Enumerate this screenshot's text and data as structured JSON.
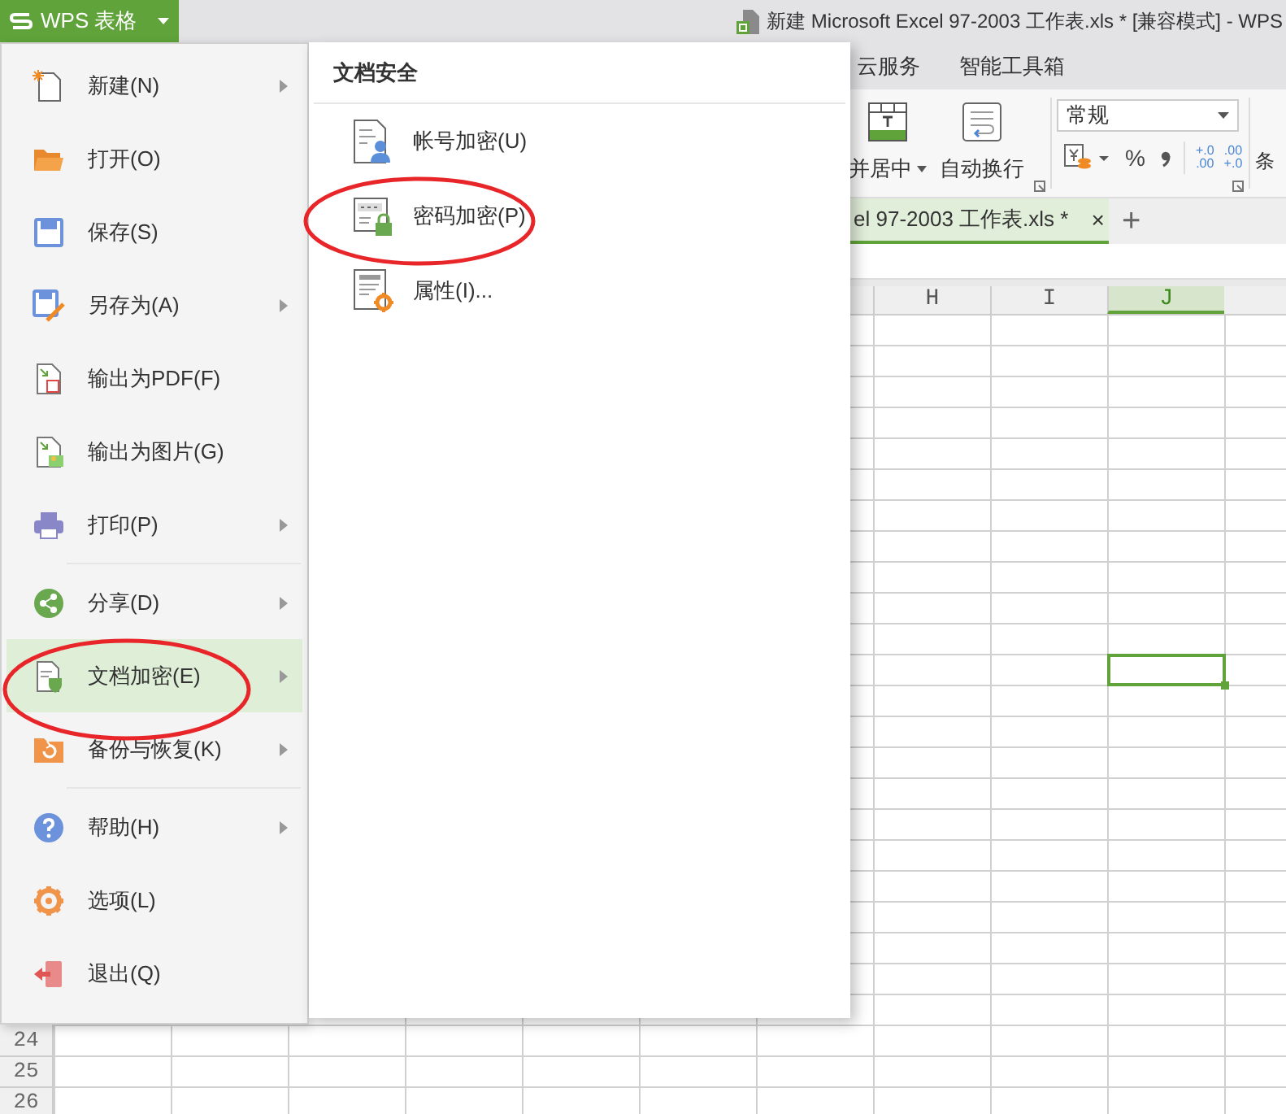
{
  "title_bar": {
    "app_button": "WPS 表格",
    "document_title": "新建 Microsoft Excel 97-2003 工作表.xls * [兼容模式] - WPS"
  },
  "ribbon_tabs": [
    "云服务",
    "智能工具箱"
  ],
  "ribbon": {
    "merge_center": "并居中",
    "wrap_text": "自动换行",
    "number_format": "常规",
    "percent": "%",
    "decimal_buttons": [
      {
        "top": "+.0",
        "bottom": ".00"
      },
      {
        "top": ".00",
        "bottom": "+.0"
      }
    ],
    "cut_label": "条"
  },
  "document_tab": {
    "label": "el 97-2003 工作表.xls *",
    "close": "×",
    "new_tab": "+"
  },
  "columns": [
    {
      "label": "H",
      "selected": false
    },
    {
      "label": "I",
      "selected": false
    },
    {
      "label": "J",
      "selected": true
    }
  ],
  "row_numbers": [
    "24",
    "25",
    "26"
  ],
  "file_menu": {
    "items": [
      {
        "kind": "item",
        "label": "新建(N)",
        "submenu": true,
        "selected": false
      },
      {
        "kind": "item",
        "label": "打开(O)",
        "submenu": false,
        "selected": false
      },
      {
        "kind": "item",
        "label": "保存(S)",
        "submenu": false,
        "selected": false
      },
      {
        "kind": "item",
        "label": "另存为(A)",
        "submenu": true,
        "selected": false
      },
      {
        "kind": "item",
        "label": "输出为PDF(F)",
        "submenu": false,
        "selected": false
      },
      {
        "kind": "item",
        "label": "输出为图片(G)",
        "submenu": false,
        "selected": false
      },
      {
        "kind": "item",
        "label": "打印(P)",
        "submenu": true,
        "selected": false
      },
      {
        "kind": "separator"
      },
      {
        "kind": "item",
        "label": "分享(D)",
        "submenu": true,
        "selected": false
      },
      {
        "kind": "item",
        "label": "文档加密(E)",
        "submenu": true,
        "selected": true
      },
      {
        "kind": "item",
        "label": "备份与恢复(K)",
        "submenu": true,
        "selected": false
      },
      {
        "kind": "separator"
      },
      {
        "kind": "item",
        "label": "帮助(H)",
        "submenu": true,
        "selected": false
      },
      {
        "kind": "item",
        "label": "选项(L)",
        "submenu": false,
        "selected": false
      },
      {
        "kind": "item",
        "label": "退出(Q)",
        "submenu": false,
        "selected": false
      }
    ]
  },
  "submenu": {
    "title": "文档安全",
    "items": [
      {
        "label": "帐号加密(U)"
      },
      {
        "label": "密码加密(P)"
      },
      {
        "label": "属性(I)..."
      }
    ]
  }
}
